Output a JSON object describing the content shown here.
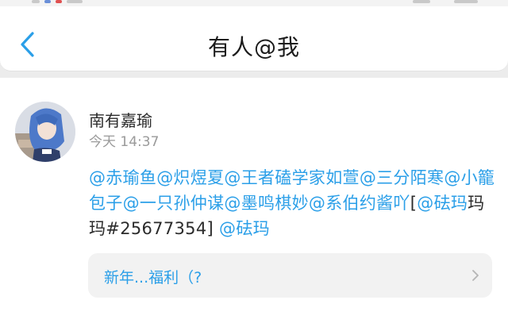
{
  "header": {
    "title": "有人@我",
    "back_icon": "chevron-left-icon",
    "accent": "#2b9fe8"
  },
  "post": {
    "user_name": "南有嘉瑜",
    "time": "今天 14:37",
    "avatar_icon": "avatar",
    "message": {
      "m1": "@赤瑜鱼",
      "m2": "@炽煜夏",
      "m3": "@王者磕学家如萱",
      "m4": "@三分陌寒",
      "m5": "@小籠包子",
      "m6": "@一只孙仲谋",
      "m7": "@墨鸣棋妙",
      "m8": "@系伯约酱吖",
      "bracket_open": "[",
      "m9": "@砝玛",
      "tail": "玛玛#25677354]",
      "space": " ",
      "m10": "@砝玛"
    },
    "quote": {
      "text": "新年...福利（?",
      "icon": "chevron-right-icon"
    }
  },
  "colors": {
    "mention": "#2b9fe8",
    "text": "#2b2b2b",
    "secondary": "#9a9a9a",
    "background": "#ececec"
  }
}
